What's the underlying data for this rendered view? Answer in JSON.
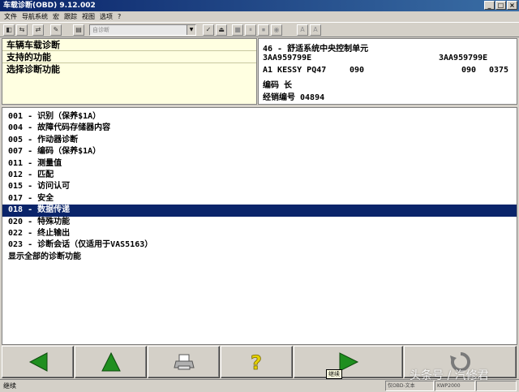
{
  "window": {
    "title": "车载诊断(OBD) 9.12.002"
  },
  "menu": [
    "文件",
    "导航系统",
    "宏",
    "跟踪",
    "视图",
    "选项",
    "?"
  ],
  "toolbar": {
    "combo_value": "自诊断",
    "buttons": [
      "◧",
      "⇆",
      "⇄",
      "✎",
      "▤",
      "✓",
      "⏏",
      "■",
      "⏸",
      "⏹",
      "◉",
      "A",
      "A"
    ]
  },
  "left_panel": {
    "items": [
      "车辆车载诊断",
      "支持的功能",
      "选择诊断功能"
    ]
  },
  "ecu_info": {
    "line1": "46 - 舒适系统中央控制单元",
    "part_left": "3AA959799E",
    "part_right": "3AA959799E",
    "system": "A1 KESSY PQ47",
    "coding_a": "090",
    "coding_b": "090",
    "coding_c": "0375",
    "code_label": "编码 长",
    "dealer_label": "经销编号 04894"
  },
  "functions": [
    "001 - 识别（保养$1A）",
    "004 - 故障代码存储器内容",
    "005 - 作动器诊断",
    "007 - 编码（保养$1A）",
    "011 - 测量值",
    "012 - 匹配",
    "015 - 访问认可",
    "017 - 安全",
    "018 - 数据传递",
    "020 - 特殊功能",
    "022 - 终止输出",
    "023 - 诊断会话（仅适用于VAS5163）",
    "显示全部的诊断功能"
  ],
  "selected_index": 8,
  "bottom_buttons": {
    "back": "back-arrow-icon",
    "up": "up-arrow-icon",
    "print": "printer-icon",
    "help": "help-icon",
    "next": "next-arrow-icon",
    "refresh": "refresh-icon"
  },
  "tooltip": "继续",
  "status": {
    "left": "继续",
    "cell1": "仅OBD-文本",
    "cell2": "KWP2000"
  },
  "watermark": "头条号 / 汽修君",
  "colors": {
    "selection": "#0a246a",
    "arrow_green": "#1f8f1f",
    "left_panel_bg": "#ffffe1"
  }
}
